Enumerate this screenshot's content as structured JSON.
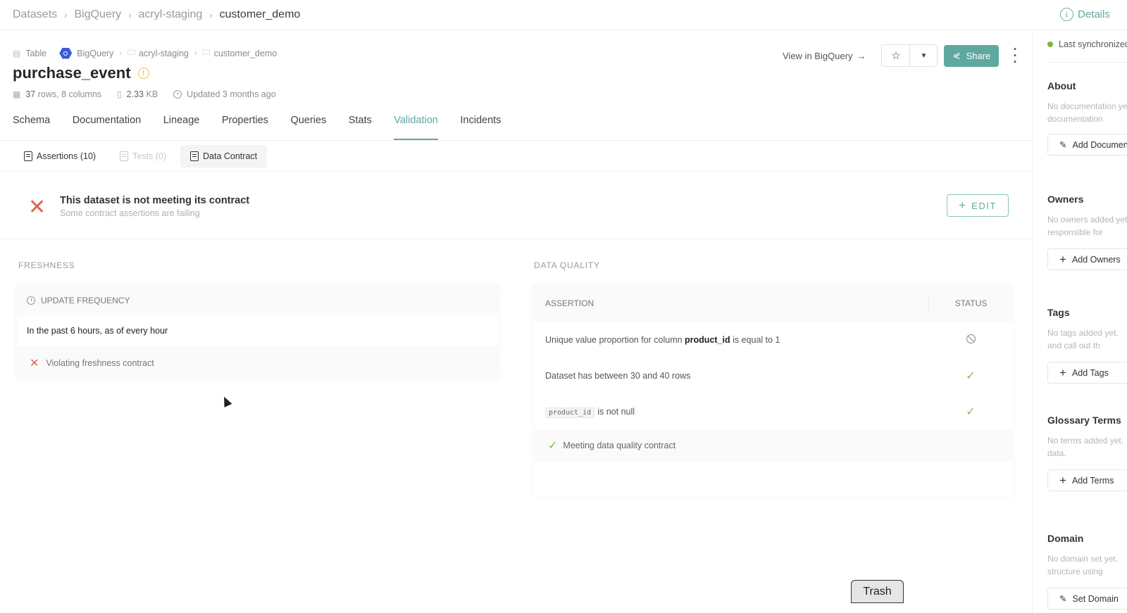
{
  "topbar": {
    "breadcrumb": [
      "Datasets",
      "BigQuery",
      "acryl-staging",
      "customer_demo"
    ],
    "details_label": "Details"
  },
  "entity": {
    "type": "Table",
    "platform": "BigQuery",
    "path": [
      "acryl-staging",
      "customer_demo"
    ],
    "name": "purchase_event",
    "rows_count": "37",
    "rows_text": "rows, 8 columns",
    "size_value": "2.33",
    "size_unit": "KB",
    "updated": "Updated 3 months ago"
  },
  "actions": {
    "view_in": "View in BigQuery",
    "share": "Share"
  },
  "tabs": [
    "Schema",
    "Documentation",
    "Lineage",
    "Properties",
    "Queries",
    "Stats",
    "Validation",
    "Incidents"
  ],
  "active_tab": "Validation",
  "subtabs": {
    "assertions": "Assertions (10)",
    "tests": "Tests (0)",
    "contract": "Data Contract"
  },
  "contract": {
    "title": "This dataset is not meeting its contract",
    "subtitle": "Some contract assertions are failing",
    "edit_label": "EDIT"
  },
  "freshness": {
    "section_label": "FRESHNESS",
    "header": "UPDATE FREQUENCY",
    "value": "In the past 6 hours, as of every hour",
    "status": "Violating freshness contract"
  },
  "data_quality": {
    "section_label": "DATA QUALITY",
    "col_assertion": "ASSERTION",
    "col_status": "STATUS",
    "rows": [
      {
        "prefix": "Unique value proportion for column ",
        "bold": "product_id",
        "suffix": " is equal to 1",
        "status": "inactive"
      },
      {
        "text": "Dataset has between 30 and 40 rows",
        "status": "passing"
      },
      {
        "code": "product_id",
        "suffix": "is not null",
        "status": "passing"
      }
    ],
    "footer": "Meeting data quality contract"
  },
  "sidebar": {
    "sync": "Last synchronized",
    "about": {
      "title": "About",
      "desc1": "No documentation yet.",
      "desc2": "documentation",
      "button": "Add Documentation"
    },
    "owners": {
      "title": "Owners",
      "desc1": "No owners added yet.",
      "desc2": "responsible for",
      "button": "Add Owners"
    },
    "tags": {
      "title": "Tags",
      "desc1": "No tags added yet.",
      "desc2": "and call out th",
      "button": "Add Tags"
    },
    "glossary": {
      "title": "Glossary Terms",
      "desc1": "No terms added yet.",
      "desc2": "data.",
      "button": "Add Terms"
    },
    "domain": {
      "title": "Domain",
      "desc1": "No domain set yet.",
      "desc2": "structure using",
      "button": "Set Domain"
    }
  },
  "dock": {
    "trash": "Trash"
  },
  "colors": {
    "accent": "#5fa89f",
    "error": "#e0624e",
    "success": "#7dbb5e",
    "warning": "#e6c35a"
  }
}
